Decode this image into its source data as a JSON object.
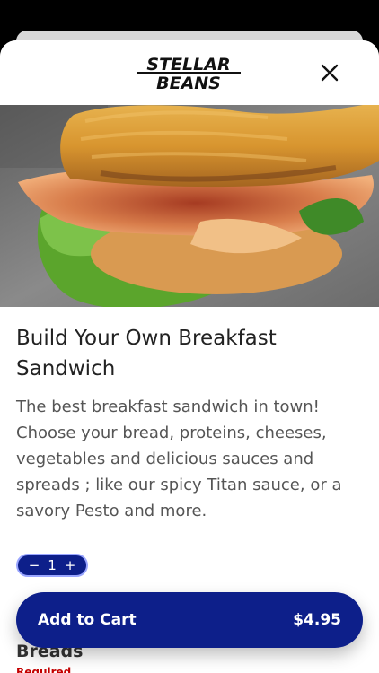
{
  "brand": {
    "logo_line1": "STELLAR",
    "logo_line2": "BEANS"
  },
  "header": {
    "close_icon": "close-icon"
  },
  "item": {
    "title": "Build Your Own Breakfast Sandwich",
    "description": "The best breakfast sandwich in town! Choose your bread, proteins, cheeses, vegetables and delicious sauces and spreads ; like our spicy Titan sauce, or a savory Pesto and more.",
    "quantity": "1",
    "minus_label": "−",
    "plus_label": "+"
  },
  "cart": {
    "label": "Add to Cart",
    "price": "$4.95"
  },
  "sections": [
    {
      "title": "Breads",
      "status": "Required"
    }
  ],
  "colors": {
    "primary": "#0d1f8a",
    "required": "#c40000"
  }
}
